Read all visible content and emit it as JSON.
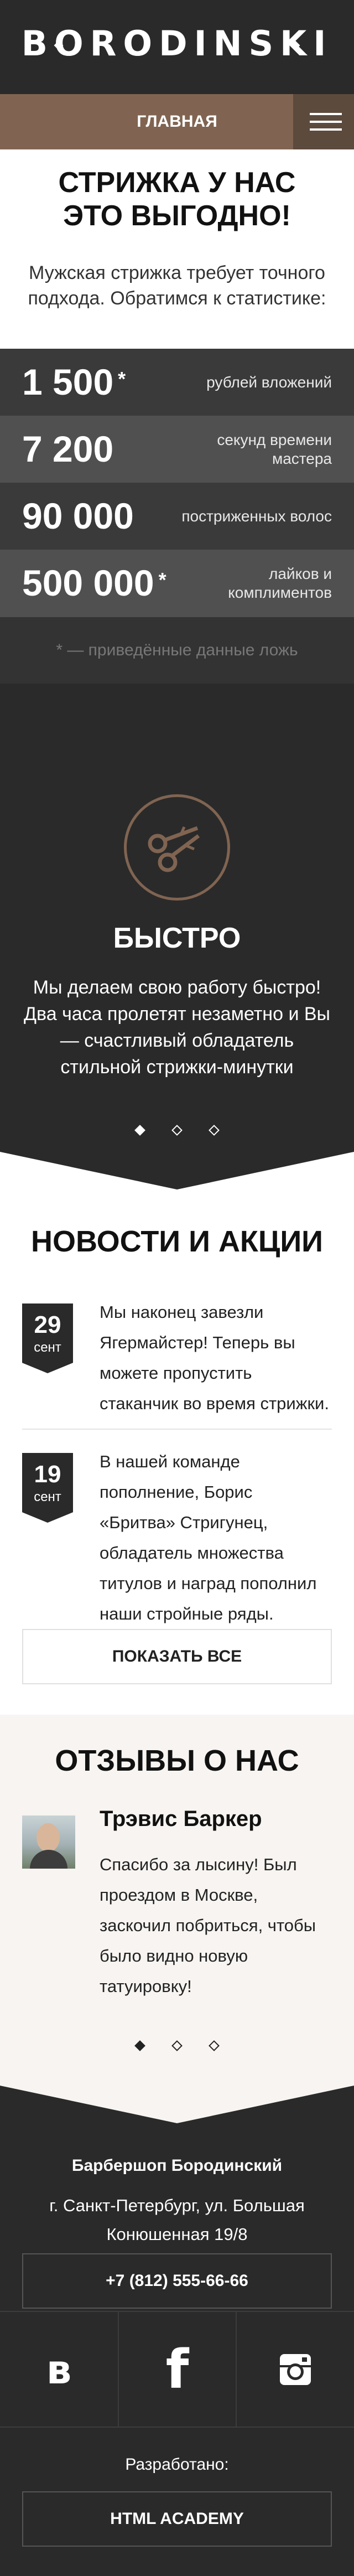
{
  "header": {
    "logo": "BORODINSKI",
    "nav_current": "ГЛАВНАЯ"
  },
  "promo": {
    "title_line1": "СТРИЖКА У НАС",
    "title_line2": "ЭТО ВЫГОДНО!",
    "text": "Мужская стрижка требует точного подхода. Обратимся к статистике:"
  },
  "stats": [
    {
      "value": "1 500",
      "mark": "*",
      "label": "рублей вложений",
      "color": "#3a3a3a"
    },
    {
      "value": "7 200",
      "mark": "",
      "label": "секунд времени мастера",
      "color": "#505050"
    },
    {
      "value": "90 000",
      "mark": "",
      "label": "постриженных волос",
      "color": "#3a3a3a"
    },
    {
      "value": "500 000",
      "mark": "*",
      "label": "лайков и комплиментов",
      "color": "#505050"
    }
  ],
  "stats_note": "* — приведённые данные ложь",
  "features": {
    "icon": "scissors-icon",
    "title": "БЫСТРО",
    "text": "Мы делаем свою работу быстро! Два часа пролетят незаметно и Вы — счастливый обладатель стильной стрижки-минутки",
    "slides": 3,
    "active_slide": 1
  },
  "news": {
    "title": "НОВОСТИ И АКЦИИ",
    "items": [
      {
        "day": "29",
        "month": "сент",
        "text": "Мы наконец завезли Ягермайстер! Теперь вы можете пропустить стаканчик во время стрижки."
      },
      {
        "day": "19",
        "month": "сент",
        "text": "В нашей команде пополнение, Борис «Бритва» Стригунец, обладатель множества титулов и наград пополнил наши стройные ряды. Спешите записаться!"
      }
    ],
    "show_all": "ПОКАЗАТЬ ВСЕ"
  },
  "reviews": {
    "title": "ОТЗЫВЫ О НАС",
    "name": "Трэвис Баркер",
    "text": "Спасибо за лысину! Был проездом в Москве, заскочил побриться, чтобы было видно новую татуировку!",
    "slides": 3,
    "active_slide": 1
  },
  "footer": {
    "name": "Барбершоп Бородинский",
    "address": "г. Санкт-Петербург, ул. Большая Конюшенная 19/8",
    "phone": "+7 (812) 555-66-66",
    "socials": [
      {
        "label": "в",
        "icon": "vk-icon"
      },
      {
        "label": "f",
        "icon": "facebook-icon"
      },
      {
        "label": "",
        "icon": "instagram-icon"
      }
    ],
    "developed_label": "Разработано:",
    "developer": "HTML ACADEMY"
  },
  "colors": {
    "dark": "#2a2a2a",
    "brown": "#806451",
    "brown_dark": "#5c4a3c",
    "light_bg": "#f7f4f1"
  }
}
